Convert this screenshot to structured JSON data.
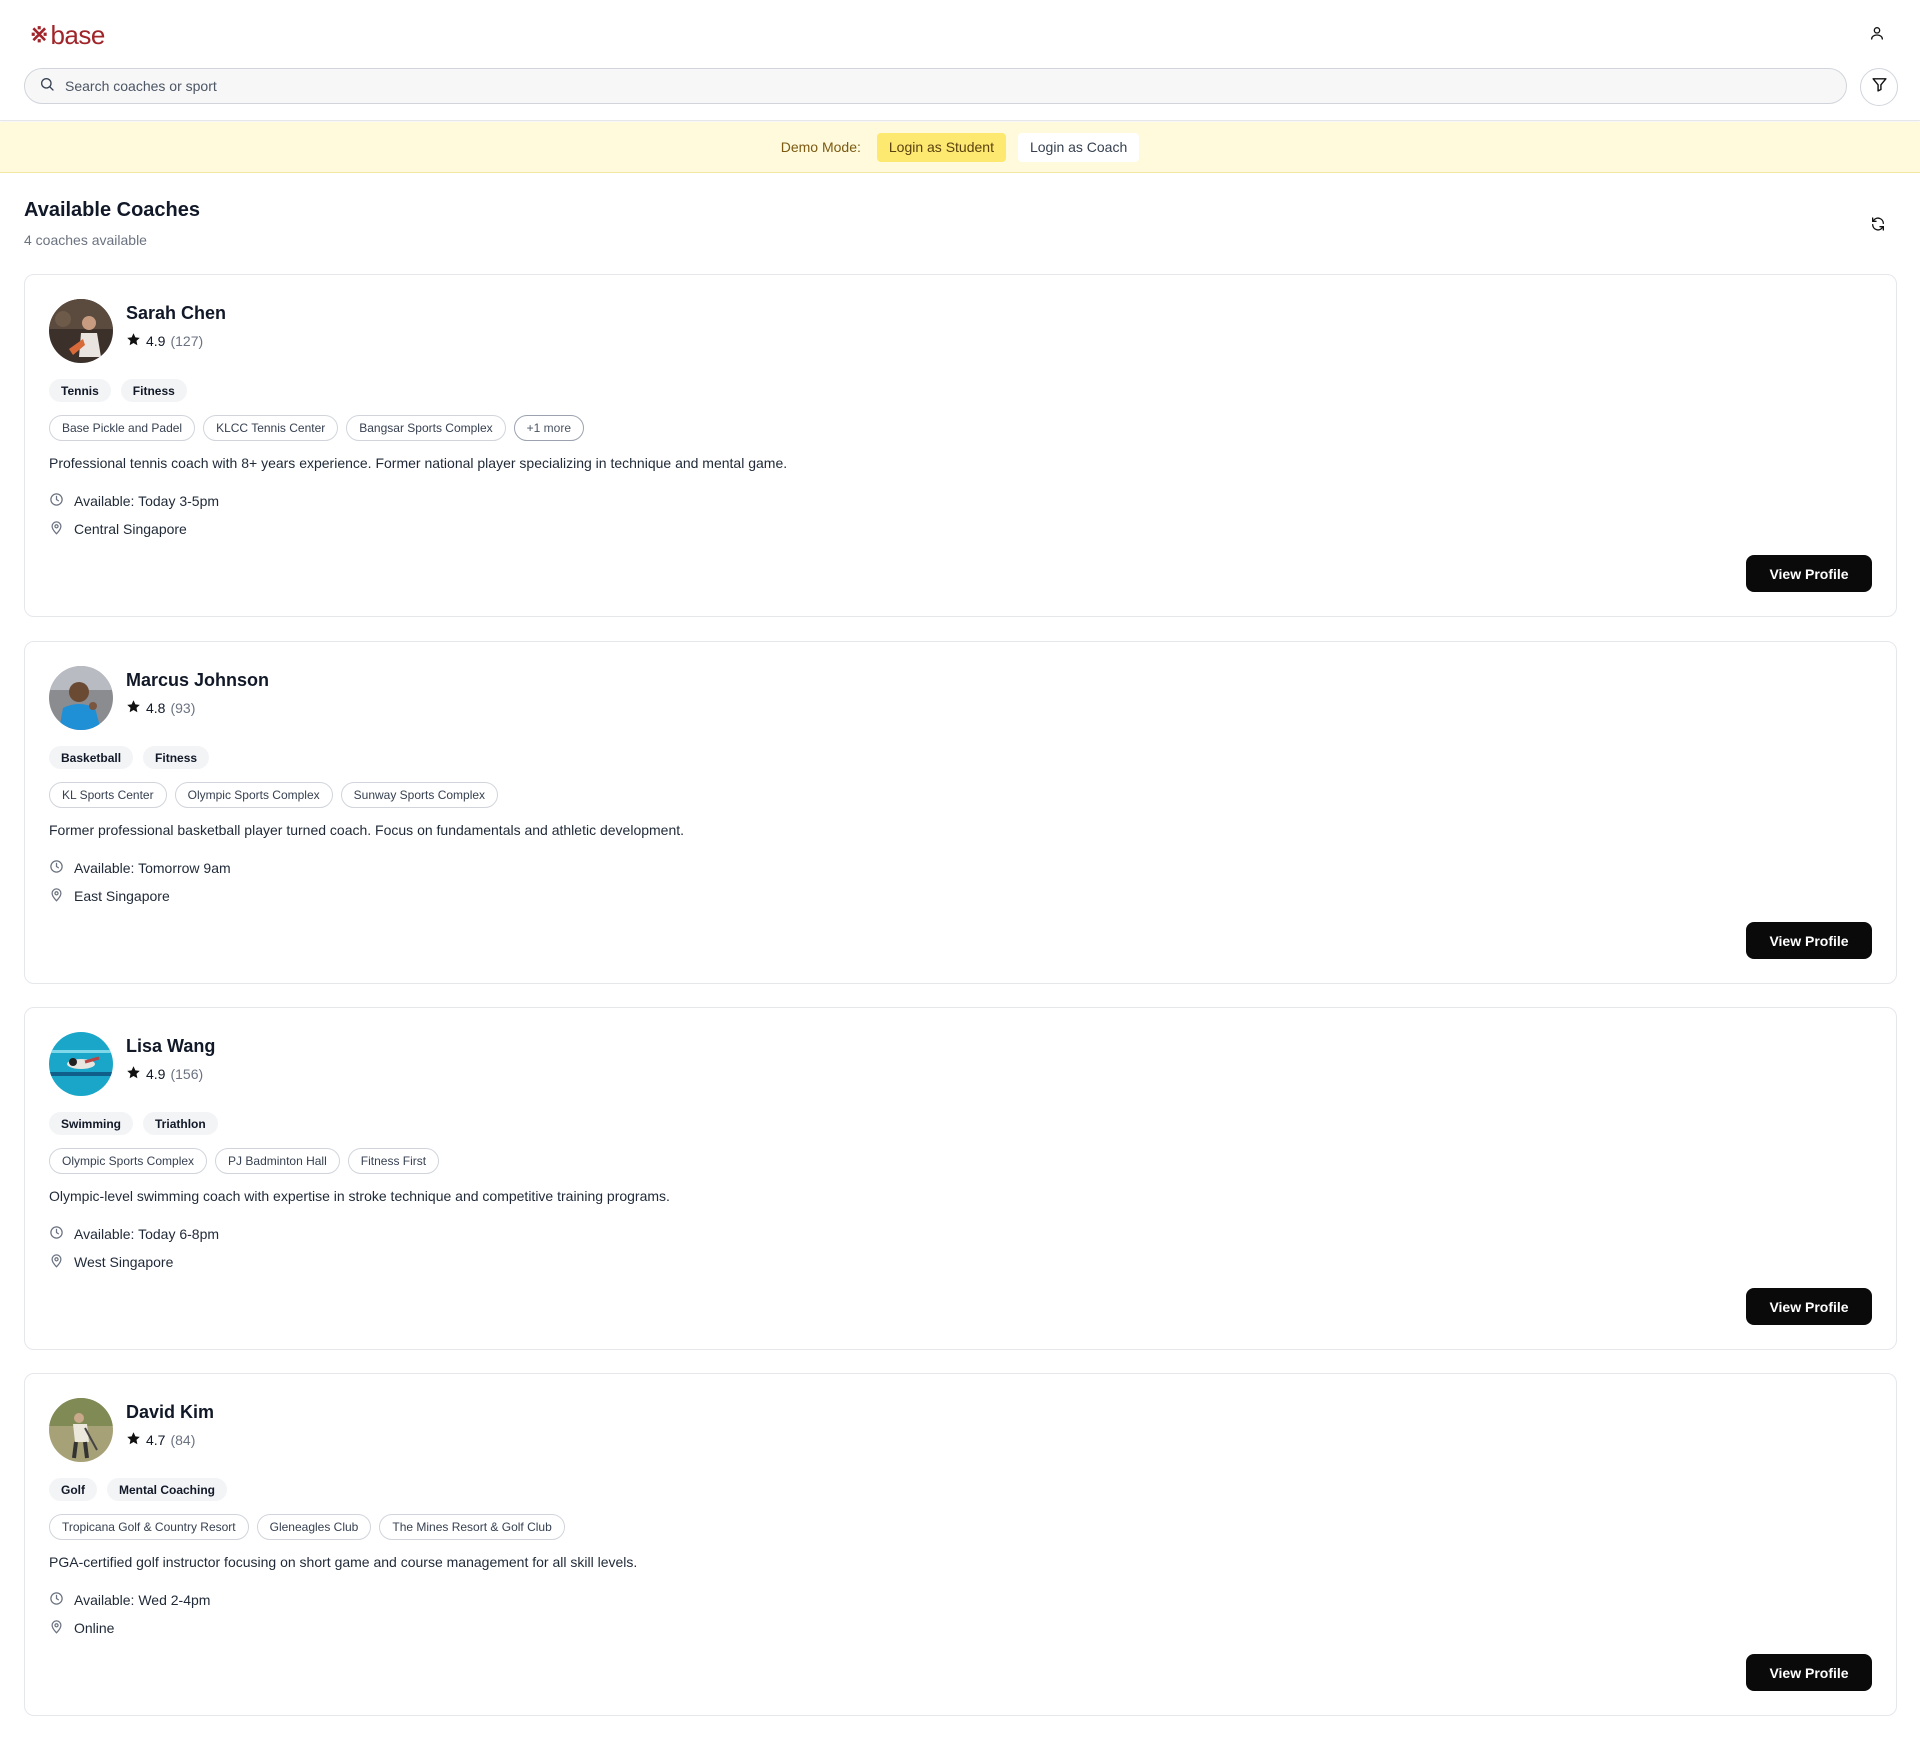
{
  "brand": {
    "logo_mark": "※",
    "logo_text": "base",
    "color": "#a0252a"
  },
  "search": {
    "placeholder": "Search coaches or sport"
  },
  "demo": {
    "label": "Demo Mode:",
    "student_label": "Login as Student",
    "coach_label": "Login as Coach"
  },
  "section": {
    "title": "Available Coaches",
    "subtitle": "4 coaches available"
  },
  "icons": {
    "user": "user-icon",
    "search": "search-icon",
    "filter": "filter-icon",
    "refresh": "refresh-icon",
    "star": "star-icon",
    "clock": "clock-icon",
    "pin": "map-pin-icon"
  },
  "coaches": [
    {
      "name": "Sarah Chen",
      "rating": "4.9",
      "reviews": "(127)",
      "sports": [
        "Tennis",
        "Fitness"
      ],
      "venues": [
        "Base Pickle and Padel",
        "KLCC Tennis Center",
        "Bangsar Sports Complex"
      ],
      "more": "+1 more",
      "description": "Professional tennis coach with 8+ years experience. Former national player specializing in technique and mental game.",
      "availability": "Available: Today 3-5pm",
      "location": "Central Singapore",
      "button": "View Profile"
    },
    {
      "name": "Marcus Johnson",
      "rating": "4.8",
      "reviews": "(93)",
      "sports": [
        "Basketball",
        "Fitness"
      ],
      "venues": [
        "KL Sports Center",
        "Olympic Sports Complex",
        "Sunway Sports Complex"
      ],
      "more": "",
      "description": "Former professional basketball player turned coach. Focus on fundamentals and athletic development.",
      "availability": "Available: Tomorrow 9am",
      "location": "East Singapore",
      "button": "View Profile"
    },
    {
      "name": "Lisa Wang",
      "rating": "4.9",
      "reviews": "(156)",
      "sports": [
        "Swimming",
        "Triathlon"
      ],
      "venues": [
        "Olympic Sports Complex",
        "PJ Badminton Hall",
        "Fitness First"
      ],
      "more": "",
      "description": "Olympic-level swimming coach with expertise in stroke technique and competitive training programs.",
      "availability": "Available: Today 6-8pm",
      "location": "West Singapore",
      "button": "View Profile"
    },
    {
      "name": "David Kim",
      "rating": "4.7",
      "reviews": "(84)",
      "sports": [
        "Golf",
        "Mental Coaching"
      ],
      "venues": [
        "Tropicana Golf & Country Resort",
        "Gleneagles Club",
        "The Mines Resort & Golf Club"
      ],
      "more": "",
      "description": "PGA-certified golf instructor focusing on short game and course management for all skill levels.",
      "availability": "Available: Wed 2-4pm",
      "location": "Online",
      "button": "View Profile"
    }
  ]
}
